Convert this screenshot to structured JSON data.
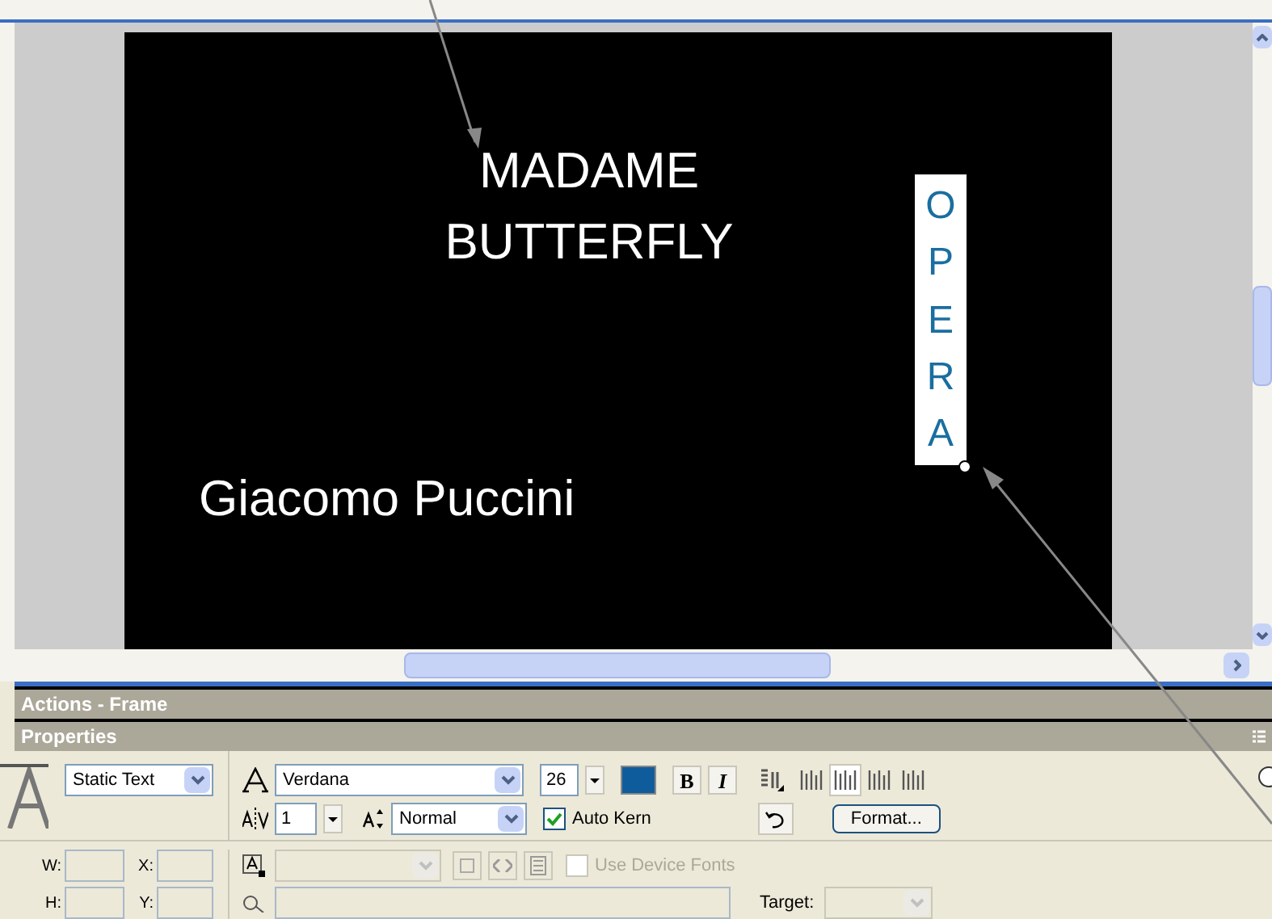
{
  "stage": {
    "title": "MADAME BUTTERFLY",
    "subtitle": "Giacomo Puccini",
    "vertical_text": "OPERA"
  },
  "panels": [
    {
      "title": "Actions - Frame"
    },
    {
      "title": "Properties"
    }
  ],
  "properties": {
    "text_type": "Static Text",
    "font": "Verdana",
    "font_size": "26",
    "text_color": {
      "color": "#0f5c9c"
    },
    "bold_button": "B",
    "italic_button": "I",
    "letter_spacing": "1",
    "baseline": "Normal",
    "auto_kern": {
      "label": "Auto Kern",
      "checked": true
    },
    "format_button": "Format...",
    "w_label": "W:",
    "x_label": "X:",
    "h_label": "H:",
    "y_label": "Y:",
    "use_device_fonts": {
      "label": "Use Device Fonts",
      "checked": false
    },
    "target_label": "Target:"
  },
  "alignment": [
    {
      "selected": false
    },
    {
      "selected": true
    },
    {
      "selected": false
    },
    {
      "selected": false
    }
  ]
}
